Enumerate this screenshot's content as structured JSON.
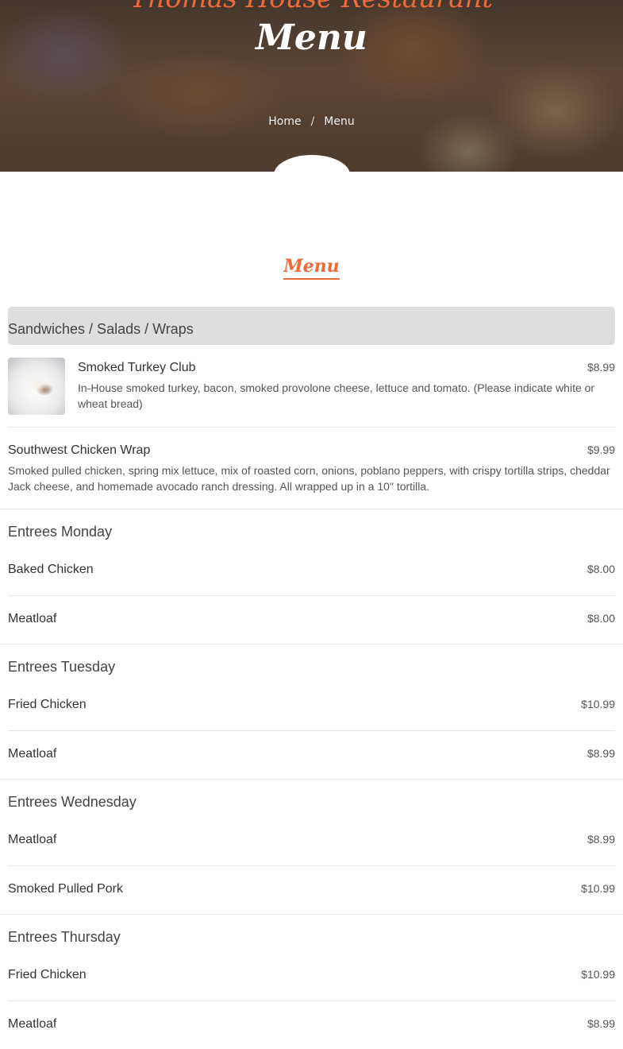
{
  "hero": {
    "restaurant_name": "Thomas House Restaurant",
    "title": "Menu",
    "breadcrumb": {
      "home": "Home",
      "separator": "/",
      "current": "Menu"
    }
  },
  "section_heading": "Menu",
  "categories": [
    {
      "title": "Sandwiches / Salads / Wraps",
      "items": [
        {
          "name": "Smoked Turkey Club",
          "price": "$8.99",
          "description": "In-House smoked turkey, bacon, smoked provolone cheese, lettuce and tomato. (Please indicate white or wheat bread)"
        },
        {
          "name": "Southwest Chicken Wrap",
          "price": "$9.99",
          "description": "Smoked pulled chicken, spring mix lettuce, mix of roasted corn, onions, poblano peppers, with crispy tortilla strips, cheddar Jack cheese, and homemade avocado ranch dressing. All wrapped up in a 10\" tortilla."
        }
      ]
    },
    {
      "title": "Entrees Monday",
      "items": [
        {
          "name": "Baked Chicken",
          "price": "$8.00"
        },
        {
          "name": "Meatloaf",
          "price": "$8.00"
        }
      ]
    },
    {
      "title": "Entrees Tuesday",
      "items": [
        {
          "name": "Fried Chicken",
          "price": "$10.99"
        },
        {
          "name": "Meatloaf",
          "price": "$8.99"
        }
      ]
    },
    {
      "title": "Entrees Wednesday",
      "items": [
        {
          "name": "Meatloaf",
          "price": "$8.99"
        },
        {
          "name": "Smoked Pulled Pork",
          "price": "$10.99"
        }
      ]
    },
    {
      "title": "Entrees Thursday",
      "items": [
        {
          "name": "Fried Chicken",
          "price": "$10.99"
        },
        {
          "name": "Meatloaf",
          "price": "$8.99"
        }
      ]
    }
  ],
  "colors": {
    "accent": "#ee6a3a",
    "category_bg": "#dedede"
  }
}
